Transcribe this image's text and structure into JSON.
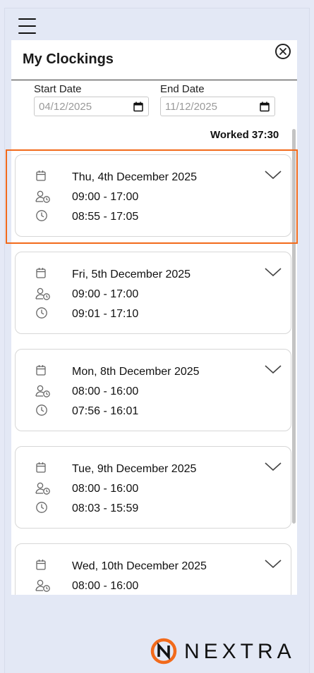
{
  "app": {
    "title": "My Clockings",
    "brand": "NEXTRA",
    "accent": "#f26a1b"
  },
  "filters": {
    "start_label": "Start Date",
    "start_value": "04/12/2025",
    "end_label": "End Date",
    "end_value": "11/12/2025"
  },
  "summary": {
    "worked": "Worked 37:30"
  },
  "icons": {
    "menu": "hamburger-icon",
    "close": "close-circle-icon",
    "calendar": "calendar-icon",
    "scheduled": "user-clock-icon",
    "actual": "clock-icon",
    "expand": "chevron-down-icon"
  },
  "clockings": [
    {
      "date": "Thu, 4th December 2025",
      "scheduled": "09:00 - 17:00",
      "actual": "08:55 - 17:05",
      "selected": true
    },
    {
      "date": "Fri, 5th December 2025",
      "scheduled": "09:00 - 17:00",
      "actual": "09:01 - 17:10"
    },
    {
      "date": "Mon, 8th December 2025",
      "scheduled": "08:00 - 16:00",
      "actual": "07:56 - 16:01"
    },
    {
      "date": "Tue, 9th December 2025",
      "scheduled": "08:00 - 16:00",
      "actual": "08:03 - 15:59"
    },
    {
      "date": "Wed, 10th December 2025",
      "scheduled": "08:00 - 16:00"
    }
  ]
}
